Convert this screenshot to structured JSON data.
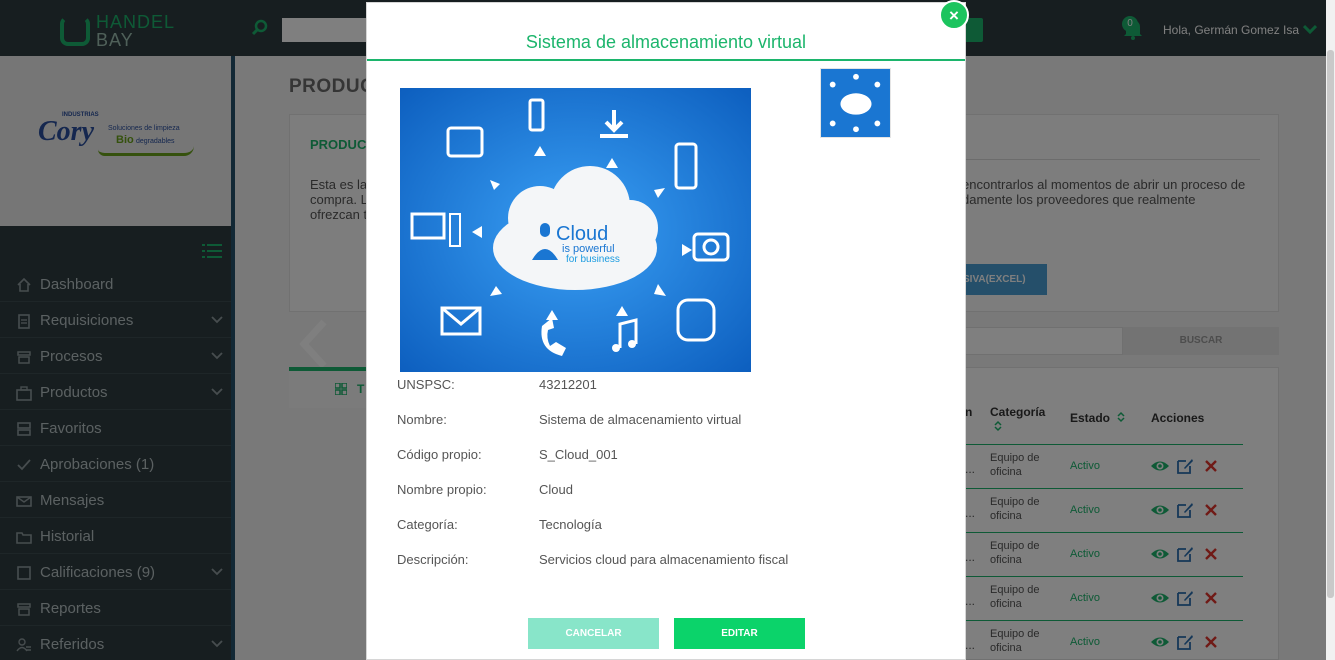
{
  "app": {
    "logo_line1": "HANDEL",
    "logo_line2": "BAY",
    "search_placeholder": "",
    "notifications_count": "0",
    "greeting": "Hola, Germán Gomez Isa",
    "brand_color": "#1cb56c"
  },
  "company_logo": {
    "industrias": "INDUSTRIAS",
    "name": "Cory",
    "tagline1": "Soluciones de limpieza",
    "bio": "Bio",
    "tagline2": "degradables"
  },
  "sidebar": {
    "items": [
      {
        "label": "Dashboard",
        "icon": "home-icon",
        "has_children": false
      },
      {
        "label": "Requisiciones",
        "icon": "clipboard-icon",
        "has_children": true
      },
      {
        "label": "Procesos",
        "icon": "stack-icon",
        "has_children": true
      },
      {
        "label": "Productos",
        "icon": "briefcase-icon",
        "has_children": true
      },
      {
        "label": "Favoritos",
        "icon": "archive-icon",
        "has_children": false
      },
      {
        "label": "Aprobaciones (1)",
        "icon": "check-icon",
        "has_children": false
      },
      {
        "label": "Mensajes",
        "icon": "envelope-icon",
        "has_children": false
      },
      {
        "label": "Historial",
        "icon": "folder-icon",
        "has_children": false
      },
      {
        "label": "Calificaciones (9)",
        "icon": "square-icon",
        "has_children": true
      },
      {
        "label": "Reportes",
        "icon": "stack-icon",
        "has_children": false
      },
      {
        "label": "Referidos",
        "icon": "users-icon",
        "has_children": true
      }
    ]
  },
  "background": {
    "page_title": "PRODUC",
    "card_heading": "PRODUC",
    "card_text_left": "Esta es la compra. L ofrezcan t",
    "card_text_right": "encontrarlos al momentos de abrir un proceso de damente los proveedores que realmente",
    "masiva_button": "SIVA(EXCEL)",
    "tab_label": "T",
    "buscar_button": "BUSCAR",
    "table": {
      "headers": {
        "cut": "n",
        "categoria": "Categoría",
        "estado": "Estado",
        "acciones": "Acciones"
      },
      "rows": [
        {
          "cut": "...",
          "categoria": "Equipo de oficina",
          "estado": "Activo"
        },
        {
          "cut": "...",
          "categoria": "Equipo de oficina",
          "estado": "Activo"
        },
        {
          "cut": "...",
          "categoria": "Equipo de oficina",
          "estado": "Activo"
        },
        {
          "cut": "...",
          "categoria": "Equipo de oficina",
          "estado": "Activo"
        },
        {
          "cut": "...",
          "categoria": "Equipo de oficina",
          "estado": "Activo"
        }
      ]
    }
  },
  "modal": {
    "title": "Sistema de almacenamiento virtual",
    "close_label": "×",
    "image_text_cloud": "Cloud",
    "image_text_powerful": "is powerful",
    "image_text_business": "for business",
    "fields": [
      {
        "label": "UNSPSC:",
        "value": "43212201"
      },
      {
        "label": "Nombre:",
        "value": "Sistema de almacenamiento virtual"
      },
      {
        "label": "Código propio:",
        "value": "S_Cloud_001"
      },
      {
        "label": "Nombre propio:",
        "value": "Cloud"
      },
      {
        "label": "Categoría:",
        "value": "Tecnología"
      },
      {
        "label": "Descripción:",
        "value": "Servicios cloud para almacenamiento fiscal"
      }
    ],
    "cancel_label": "CANCELAR",
    "edit_label": "EDITAR"
  }
}
